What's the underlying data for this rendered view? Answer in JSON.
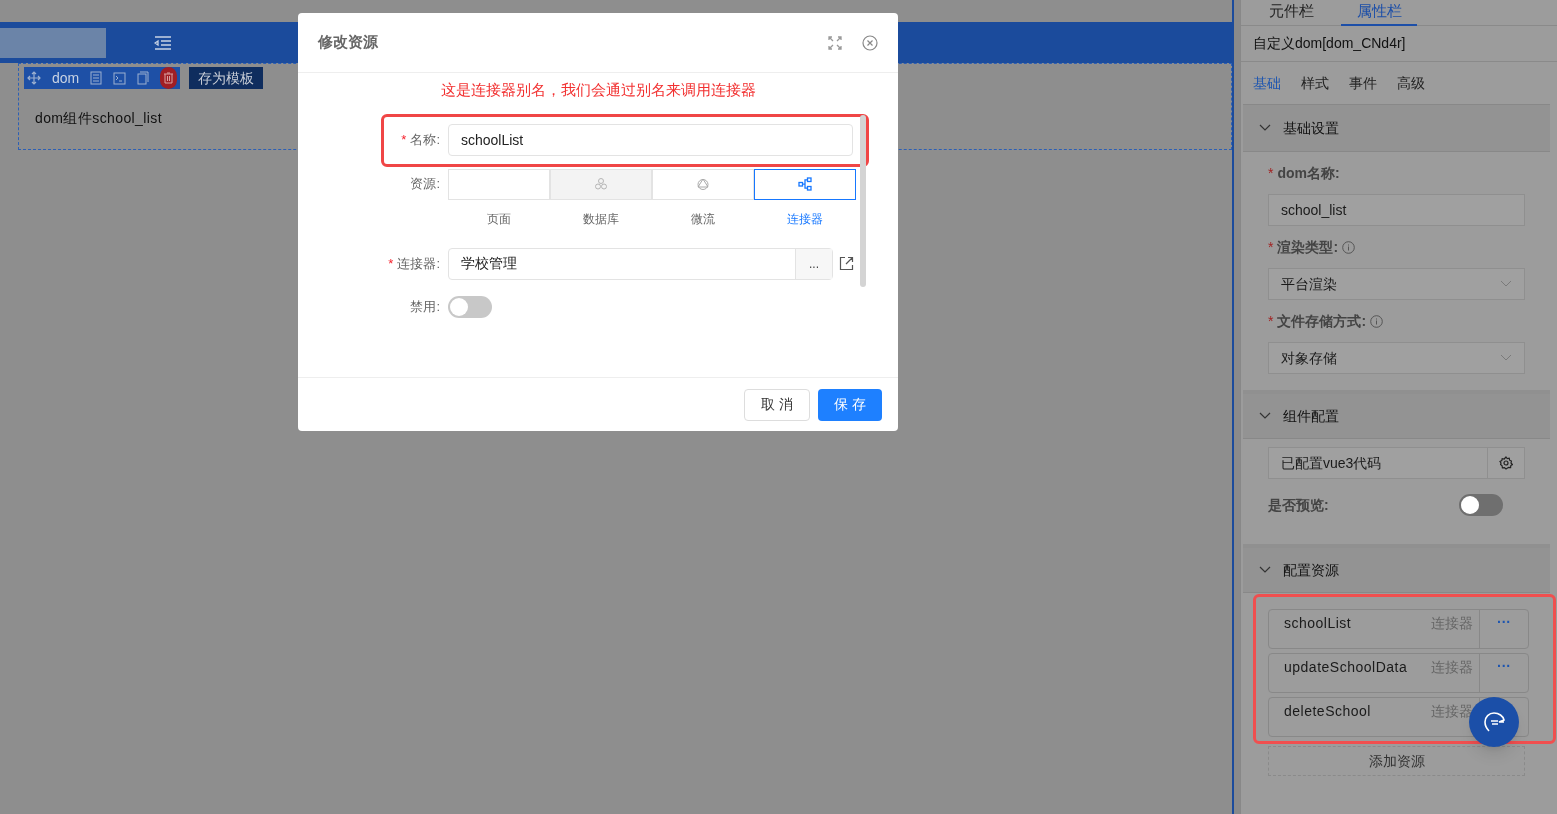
{
  "side_tabs": [
    {
      "label": "元件栏",
      "selected": false
    },
    {
      "label": "属性栏",
      "selected": true
    }
  ],
  "canvas": {
    "component_label": "dom",
    "save_template": "存为模板",
    "component_text": "dom组件school_list"
  },
  "dialog": {
    "title": "修改资源",
    "hint": "这是连接器别名，我们会通过别名来调用连接器",
    "name_field": {
      "mark": "*",
      "label": "名称:",
      "value": "schoolList"
    },
    "resource_label": "资源:",
    "resource_types": [
      {
        "kind": "page",
        "label": "页面",
        "selected": false,
        "disabled": false
      },
      {
        "kind": "database",
        "label": "数据库",
        "selected": false,
        "disabled": true
      },
      {
        "kind": "flow",
        "label": "微流",
        "selected": false,
        "disabled": false
      },
      {
        "kind": "connector",
        "label": "连接器",
        "selected": true,
        "disabled": false
      }
    ],
    "connector_field": {
      "mark": "*",
      "label": "连接器:",
      "value": "学校管理",
      "more": "..."
    },
    "disabled_switch": {
      "label": "禁用:",
      "on": false
    },
    "buttons": [
      {
        "label": "取 消",
        "primary": false
      },
      {
        "label": "保 存",
        "primary": true
      }
    ]
  },
  "panel": {
    "title": "自定义dom[dom_CNd4r]",
    "tabs": [
      {
        "label": "基础",
        "selected": true
      },
      {
        "label": "样式",
        "selected": false
      },
      {
        "label": "事件",
        "selected": false
      },
      {
        "label": "高级",
        "selected": false
      }
    ],
    "basic": {
      "title": "基础设置",
      "fields": [
        {
          "kind": "input",
          "mark": "*",
          "label": "dom名称:",
          "info": false,
          "value": "school_list"
        },
        {
          "kind": "select",
          "mark": "*",
          "label": "渲染类型:",
          "info": true,
          "value": "平台渲染"
        },
        {
          "kind": "select",
          "mark": "*",
          "label": "文件存储方式:",
          "info": true,
          "value": "对象存储"
        }
      ]
    },
    "component": {
      "title": "组件配置",
      "code_value": "已配置vue3代码",
      "preview": {
        "label": "是否预览:",
        "on": false
      }
    },
    "resources": {
      "title": "配置资源",
      "items": [
        {
          "name": "schoolList",
          "type": "连接器",
          "more": "···"
        },
        {
          "name": "updateSchoolData",
          "type": "连接器",
          "more": "···"
        },
        {
          "name": "deleteSchool",
          "type": "连接器"
        }
      ],
      "add": "添加资源"
    }
  }
}
